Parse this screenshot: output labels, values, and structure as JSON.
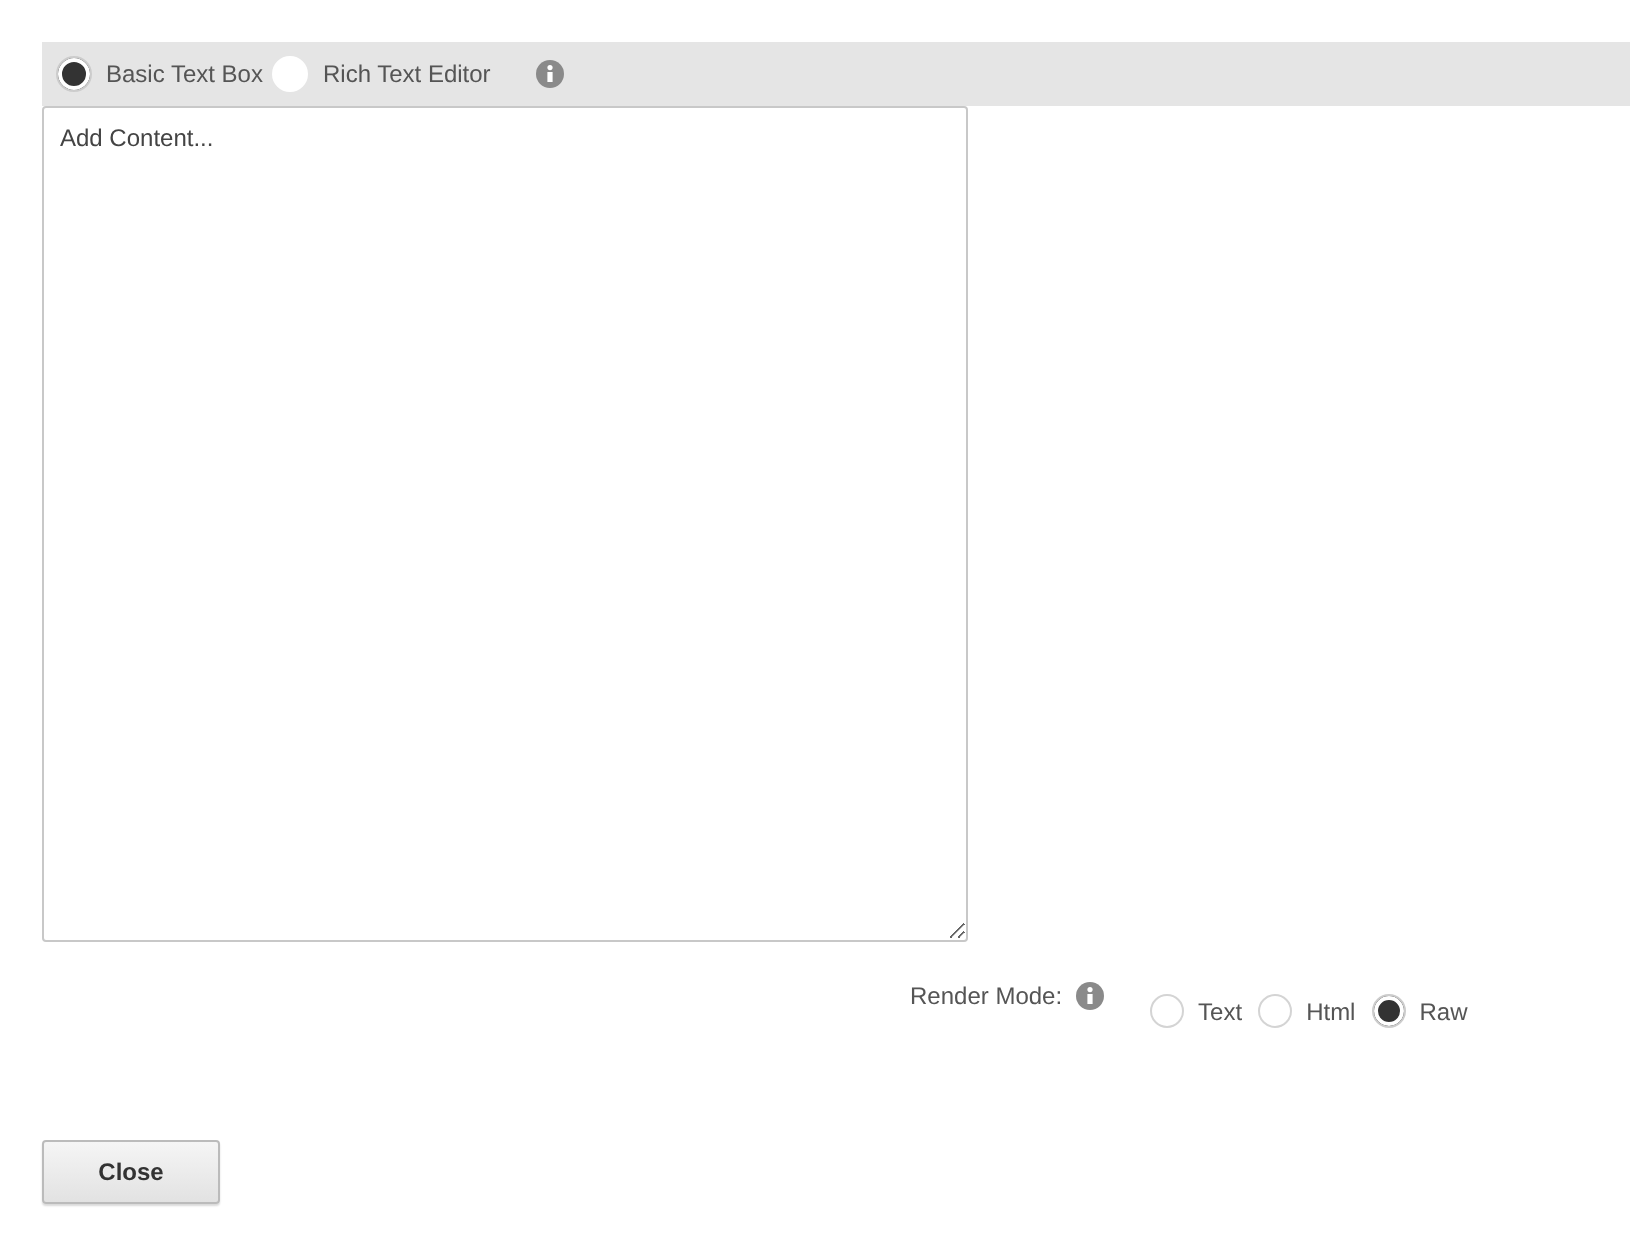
{
  "editor_modes": [
    {
      "label": "Basic Text Box",
      "selected": true
    },
    {
      "label": "Rich Text Editor",
      "selected": false
    }
  ],
  "content": {
    "placeholder": "Add Content..."
  },
  "render_mode": {
    "label": "Render Mode:",
    "options": [
      {
        "label": "Text",
        "selected": false
      },
      {
        "label": "Html",
        "selected": false
      },
      {
        "label": "Raw",
        "selected": true
      }
    ]
  },
  "buttons": [
    "Close"
  ]
}
